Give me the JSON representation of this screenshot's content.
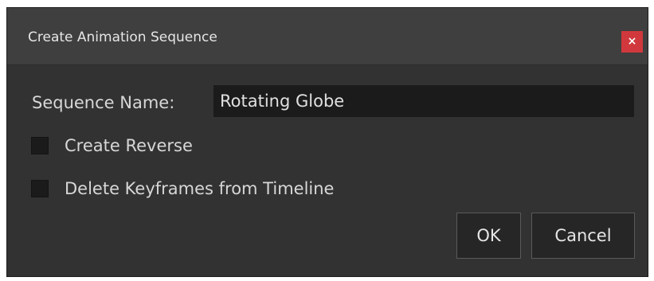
{
  "dialog": {
    "title": "Create Animation Sequence",
    "close_label": "×"
  },
  "sequence_name": {
    "label": "Sequence Name:",
    "value": "Rotating Globe"
  },
  "options": [
    {
      "label": "Create Reverse",
      "checked": false
    },
    {
      "label": "Delete Keyframes from Timeline",
      "checked": false
    }
  ],
  "buttons": {
    "ok_label": "OK",
    "cancel_label": "Cancel"
  },
  "colors": {
    "close_button": "#d1383d",
    "dialog_background": "#323232",
    "titlebar_background": "#3f3f3f"
  }
}
